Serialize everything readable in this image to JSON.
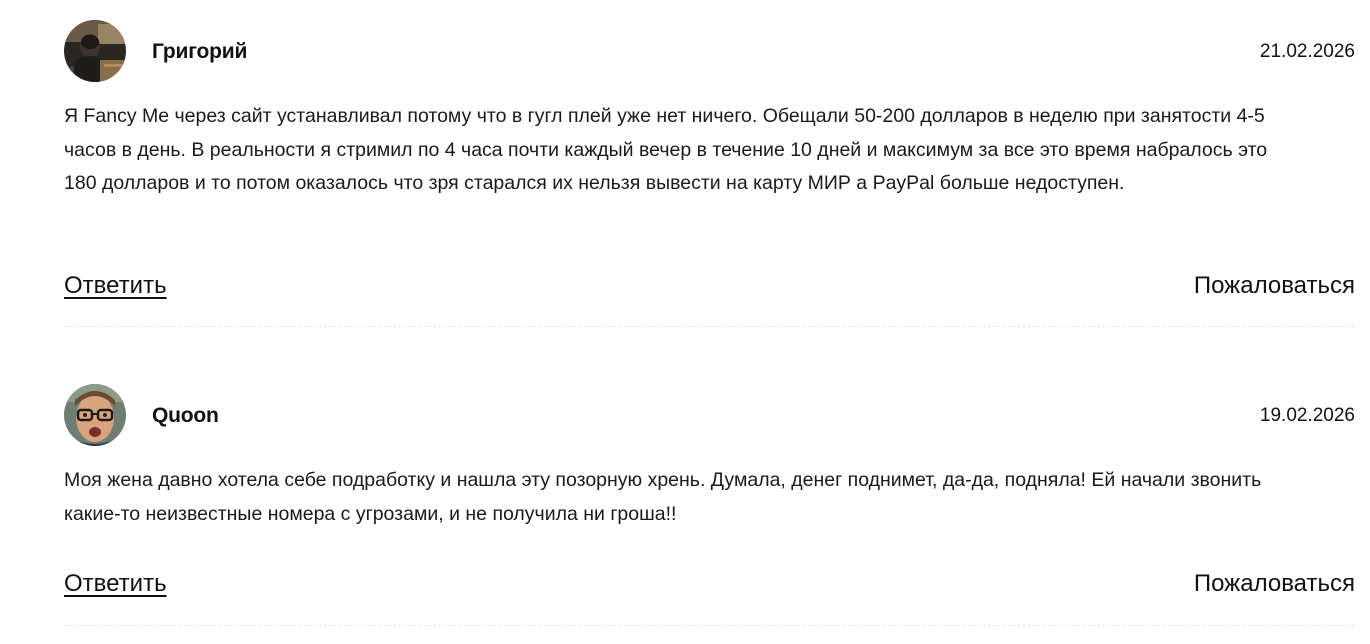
{
  "comments": [
    {
      "author": "Григорий",
      "date": "21.02.2026",
      "text": "Я Fancy Me через сайт устанавливал потому что в гугл плей уже нет ничего. Обещали 50-200 долларов в неделю при занятости 4-5 часов в день. В реальности я стримил по 4 часа почти каждый вечер в течение 10 дней и максимум за все это время набралось это 180 долларов и то потом оказалось что зря старался их нельзя вывести на карту МИР а PayPal больше недоступен.",
      "reply_label": "Ответить",
      "report_label": "Пожаловаться",
      "avatar_icon": "user-photo-avatar"
    },
    {
      "author": "Quoon",
      "date": "19.02.2026",
      "text": "Моя жена давно хотела себе подработку и нашла эту позорную хрень. Думала, денег поднимет, да-да, подняла! Ей начали звонить какие-то неизвестные номера с угрозами, и не получила ни гроша!!",
      "reply_label": "Ответить",
      "report_label": "Пожаловаться",
      "avatar_icon": "user-photo-avatar"
    }
  ]
}
